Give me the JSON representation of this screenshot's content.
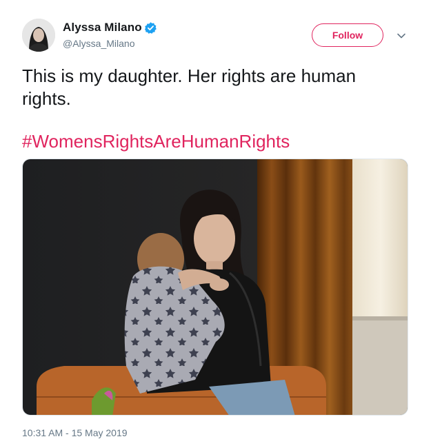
{
  "author": {
    "name": "Alyssa Milano",
    "handle": "@Alyssa_Milano",
    "verified_icon": "verified-badge-icon",
    "avatar_icon": "profile-photo"
  },
  "actions": {
    "follow_label": "Follow",
    "menu_icon": "chevron-down-icon"
  },
  "tweet": {
    "text": "This is my daughter. Her rights are human rights.",
    "hashtag": "#WomensRightsAreHumanRights",
    "media_icon": "photo",
    "timestamp": "10:31 AM - 15 May 2019"
  },
  "colors": {
    "accent": "#e0245e",
    "verified": "#1da1f2",
    "text": "#14171a",
    "secondary": "#657786"
  }
}
